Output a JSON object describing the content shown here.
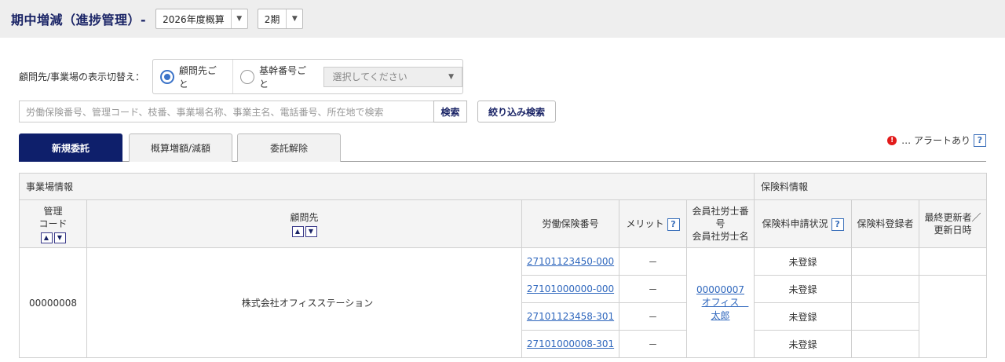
{
  "header": {
    "title": "期中増減（進捗管理）-",
    "year_select": "2026年度概算",
    "period_select": "2期"
  },
  "toggle": {
    "label": "顧問先/事業場の表示切替え：",
    "option1": "顧問先ごと",
    "option2": "基幹番号ごと",
    "select_placeholder": "選択してください"
  },
  "search": {
    "placeholder": "労働保険番号、管理コード、枝番、事業場名称、事業主名、電話番号、所在地で検索",
    "button": "検索",
    "filter_button": "絞り込み検索"
  },
  "tabs": [
    "新規委託",
    "概算増額/減額",
    "委託解除"
  ],
  "legend": {
    "icon_text": "!",
    "text": "… アラートあり",
    "help": "?"
  },
  "table": {
    "group_left": "事業場情報",
    "group_right": "保険料情報",
    "col_code": [
      "管理",
      "コード"
    ],
    "col_client": "顧問先",
    "col_insurance_no": "労働保険番号",
    "col_merit": "メリット",
    "col_member": [
      "会員社労士番",
      "号",
      "会員社労士名"
    ],
    "col_status": "保険料申請状況",
    "col_registrant": "保険料登録者",
    "col_updated": [
      "最終更新者／",
      "更新日時"
    ],
    "help": "?",
    "record": {
      "code": "00000008",
      "client": "株式会社オフィスステーション",
      "member_no": "00000007",
      "member_name": [
        "オフィス　",
        "太郎"
      ]
    },
    "rows": [
      {
        "insurance_no": "27101123450-000",
        "merit": "－",
        "status": "未登録"
      },
      {
        "insurance_no": "27101000000-000",
        "merit": "－",
        "status": "未登録"
      },
      {
        "insurance_no": "27101123458-301",
        "merit": "－",
        "status": "未登録"
      },
      {
        "insurance_no": "27101000008-301",
        "merit": "－",
        "status": "未登録"
      }
    ]
  }
}
